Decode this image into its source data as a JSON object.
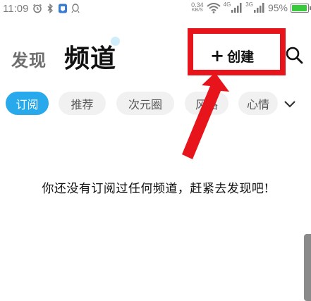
{
  "status_bar": {
    "time": "11:09",
    "speed_value": "0.34",
    "speed_unit": "KB/S",
    "net_1": "4G",
    "net_2": "3G",
    "battery_percent": "95%",
    "battery_level": 0.95,
    "icons": [
      "alarm-icon",
      "bluetooth-icon",
      "app-badge-icon",
      "qq-icon",
      "wifi-icon",
      "signal-icon",
      "signal-icon",
      "battery-icon"
    ]
  },
  "header": {
    "discover_label": "发现",
    "channel_label": "频道",
    "create_label": "创建",
    "create_plus": "+",
    "search_icon": "search-icon"
  },
  "tabs": {
    "items": [
      {
        "label": "订阅",
        "active": true
      },
      {
        "label": "推荐",
        "active": false
      },
      {
        "label": "次元圈",
        "active": false
      },
      {
        "label": "风格",
        "active": false
      },
      {
        "label": "心情",
        "active": false
      }
    ],
    "more_icon": "chevron-down-icon"
  },
  "main": {
    "empty_message": "你还没有订阅过任何频道，赶紧去发现吧!"
  },
  "colors": {
    "accent": "#27a9ec",
    "annotation_red": "#e8141b",
    "battery_green": "#38c93c"
  }
}
